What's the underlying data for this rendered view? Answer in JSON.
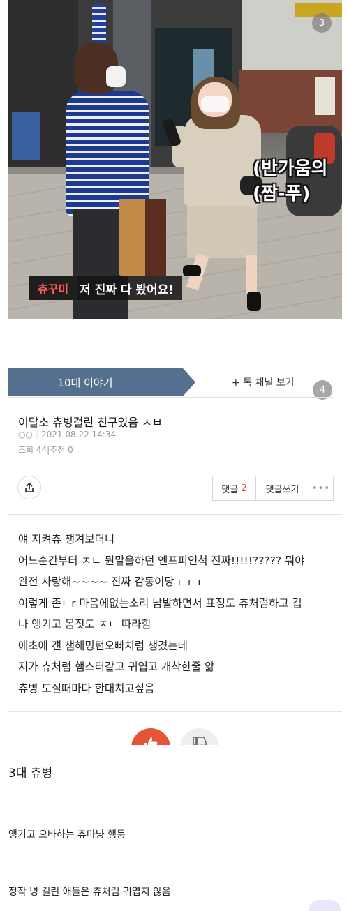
{
  "video": {
    "badge": "3",
    "overlay_line1": "(반가움의",
    "overlay_line2": "(짬-푸)",
    "caption_name": "츄꾸미",
    "caption_text": "저 진짜 다 봤어요!"
  },
  "tabs": {
    "active": "10대 이야기",
    "channel": "+ 톡 채널 보기",
    "badge": "4"
  },
  "post": {
    "title": "이달소 츄병걸린 친구있음 ㅅㅂ",
    "author": "○○",
    "date": "2021.08.22 14:34",
    "views": "조회 44",
    "recommends": "추천 0",
    "comments_label": "댓글",
    "comments_count": "2",
    "write_label": "댓글쓰기",
    "more_label": "•••",
    "body": [
      "얘 지켜츄 챙겨보더니",
      "어느순간부터 ㅈㄴ 뭔말을하던 엔프피인척 진짜!!!!!????? 뭐야",
      "완전 사랑해~~~~ 진짜 감동이당ㅜㅜㅜ",
      "이렇게 존ㄴr 마음에없는소리 남발하면서 표정도 츄처럼하고 겁",
      "나 앵기고 몸짓도 ㅈㄴ 따라함",
      "애초에 걘 샘해밍턴오빠처럼 생겼는데",
      "지가 츄처럼 햄스터같고 귀엽고 개착한줄 앎",
      "츄병 도질때마다 한대치고싶음"
    ]
  },
  "section": {
    "title": "3대 츄병",
    "line1": "앵기고 오바하는 츄마냥 행동",
    "line2": "정작 병 걸린 애들은 츄처럼 귀엽지 않음"
  },
  "colors": {
    "tab_active": "#55708f",
    "like": "#e45538",
    "comment_count": "#e04848",
    "caption_name": "#ff5a5a"
  },
  "icons": [
    "share-icon",
    "thumbs-up-icon",
    "thumbs-down-icon"
  ]
}
